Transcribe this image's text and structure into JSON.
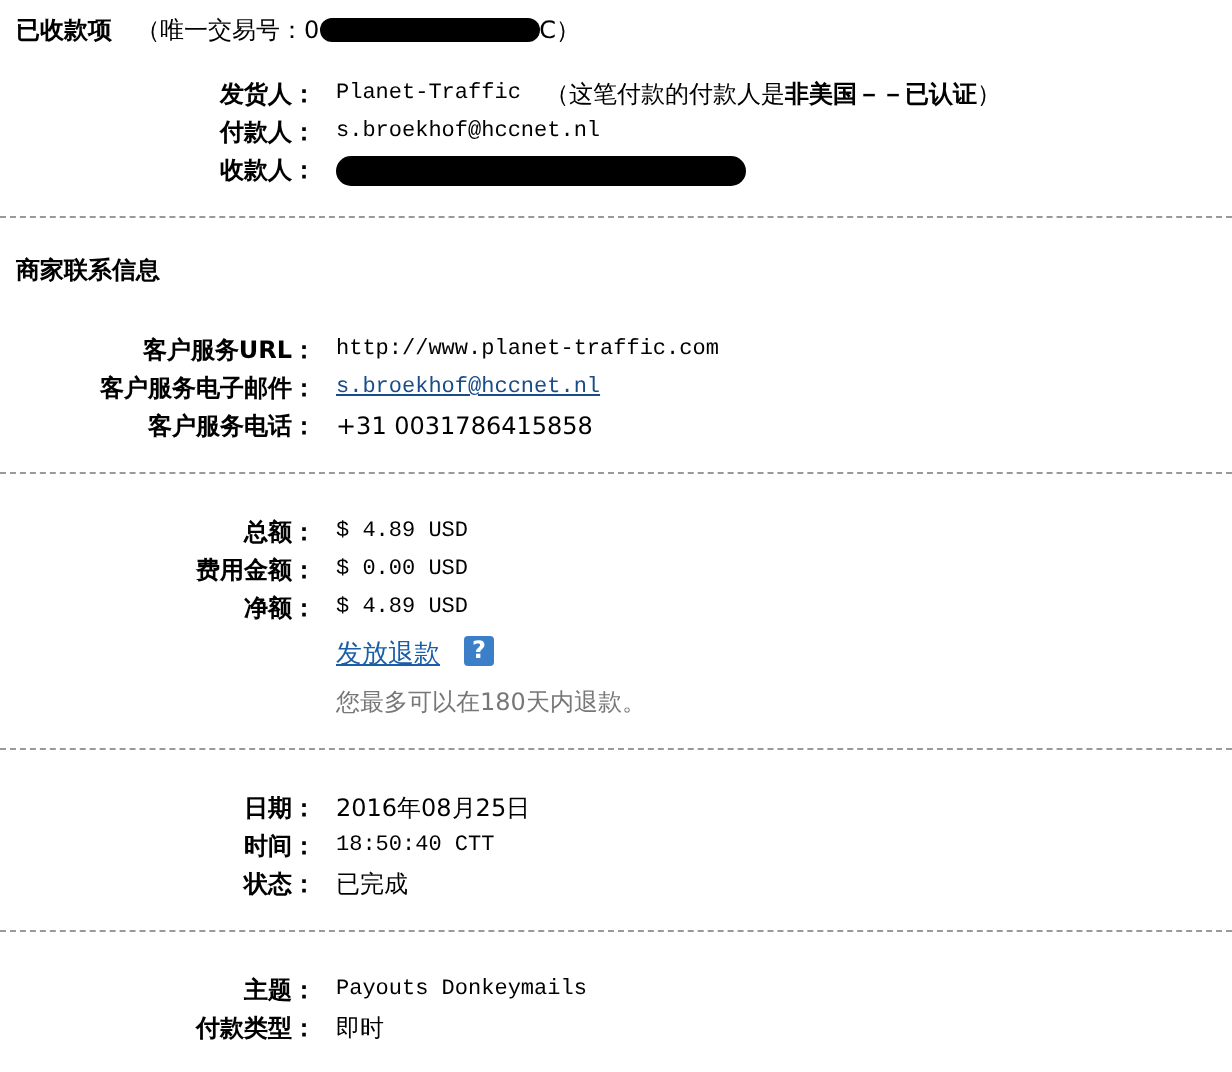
{
  "header": {
    "title": "已收款项",
    "transaction_prefix": "（唯一交易号：0",
    "transaction_suffix": "C）"
  },
  "sections": [
    {
      "rows": [
        {
          "label": "发货人：",
          "kind": "mono",
          "value": "Planet-Traffic",
          "note": "（这笔付款的付款人是**非美国－－已认证**）"
        },
        {
          "label": "付款人：",
          "kind": "mono",
          "value": "s.broekhof@hccnet.nl"
        },
        {
          "label": "收款人：",
          "kind": "redacted"
        }
      ]
    },
    {
      "title": "商家联系信息",
      "rows": [
        {
          "label": "客户服务URL：",
          "kind": "mono",
          "value": "http://www.planet-traffic.com"
        },
        {
          "label": "客户服务电子邮件：",
          "kind": "link",
          "value": "s.broekhof@hccnet.nl"
        },
        {
          "label": "客户服务电话：",
          "kind": "plain",
          "value": "+31 0031786415858"
        }
      ]
    },
    {
      "rows": [
        {
          "label": "总额：",
          "kind": "mono",
          "value": "$ 4.89 USD"
        },
        {
          "label": "费用金额：",
          "kind": "mono",
          "value": "$ 0.00 USD"
        },
        {
          "label": "净额：",
          "kind": "mono",
          "value": "$ 4.89 USD"
        }
      ],
      "refund": {
        "link": "发放退款",
        "help": "?",
        "note": "您最多可以在180天内退款。"
      }
    },
    {
      "rows": [
        {
          "label": "日期：",
          "kind": "plain",
          "value": "2016年08月25日"
        },
        {
          "label": "时间：",
          "kind": "mono",
          "value": "18:50:40 CTT"
        },
        {
          "label": "状态：",
          "kind": "plain",
          "value": "已完成"
        }
      ]
    },
    {
      "rows": [
        {
          "label": "主题：",
          "kind": "mono",
          "value": "Payouts Donkeymails"
        },
        {
          "label": "付款类型：",
          "kind": "plain",
          "value": "即时"
        }
      ]
    }
  ]
}
